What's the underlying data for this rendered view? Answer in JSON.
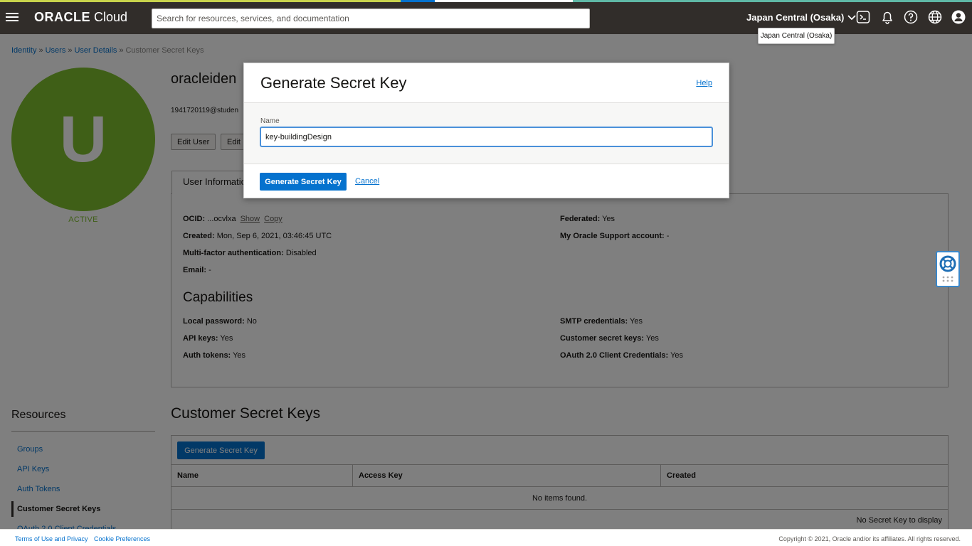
{
  "header": {
    "logo_brand": "ORACLE",
    "logo_product": "Cloud",
    "search_placeholder": "Search for resources, services, and documentation",
    "region": "Japan Central (Osaka)",
    "region_tooltip": "Japan Central (Osaka)",
    "icons": [
      "cloud-shell-icon",
      "bell-icon",
      "help-icon",
      "globe-icon",
      "profile-icon"
    ]
  },
  "breadcrumb": {
    "items": [
      "Identity",
      "Users",
      "User Details"
    ],
    "current": "Customer Secret Keys",
    "separator": "»"
  },
  "user": {
    "initial": "U",
    "status": "ACTIVE",
    "title": "oracleiden",
    "email": "1941720119@studen",
    "actions": [
      "Edit User",
      "Edit"
    ]
  },
  "user_info": {
    "tab_label": "User Informatio",
    "ocid_label": "OCID:",
    "ocid_value": "...ocvlxa",
    "show_label": "Show",
    "copy_label": "Copy",
    "created_label": "Created:",
    "created_value": "Mon, Sep 6, 2021, 03:46:45 UTC",
    "mfa_label": "Multi-factor authentication:",
    "mfa_value": "Disabled",
    "email_label": "Email:",
    "email_value": "-",
    "federated_label": "Federated:",
    "federated_value": "Yes",
    "mos_label": "My Oracle Support account:",
    "mos_value": "-"
  },
  "capabilities": {
    "heading": "Capabilities",
    "local_password_label": "Local password:",
    "local_password_value": "No",
    "api_keys_label": "API keys:",
    "api_keys_value": "Yes",
    "auth_tokens_label": "Auth tokens:",
    "auth_tokens_value": "Yes",
    "smtp_label": "SMTP credentials:",
    "smtp_value": "Yes",
    "csk_label": "Customer secret keys:",
    "csk_value": "Yes",
    "oauth_label": "OAuth 2.0 Client Credentials:",
    "oauth_value": "Yes"
  },
  "resources": {
    "title": "Resources",
    "items": [
      {
        "label": "Groups"
      },
      {
        "label": "API Keys"
      },
      {
        "label": "Auth Tokens"
      },
      {
        "label": "Customer Secret Keys"
      },
      {
        "label": "OAuth 2.0 Client Credentials"
      }
    ]
  },
  "secret_keys": {
    "heading": "Customer Secret Keys",
    "generate_button": "Generate Secret Key",
    "columns": [
      "Name",
      "Access Key",
      "Created"
    ],
    "empty_text": "No items found.",
    "no_key_text": "No Secret Key to display"
  },
  "modal": {
    "title": "Generate Secret Key",
    "help_link": "Help",
    "name_label": "Name",
    "name_value": "key-buildingDesign",
    "generate_button": "Generate Secret Key",
    "cancel_link": "Cancel"
  },
  "footer": {
    "terms": "Terms of Use and Privacy",
    "cookies": "Cookie Preferences",
    "copyright": "Copyright © 2021, Oracle and/or its affiliates. All rights reserved."
  },
  "colors": {
    "header_bg": "#312d2a",
    "accent_blue": "#0572ce",
    "avatar_green": "#7fbe2f"
  }
}
